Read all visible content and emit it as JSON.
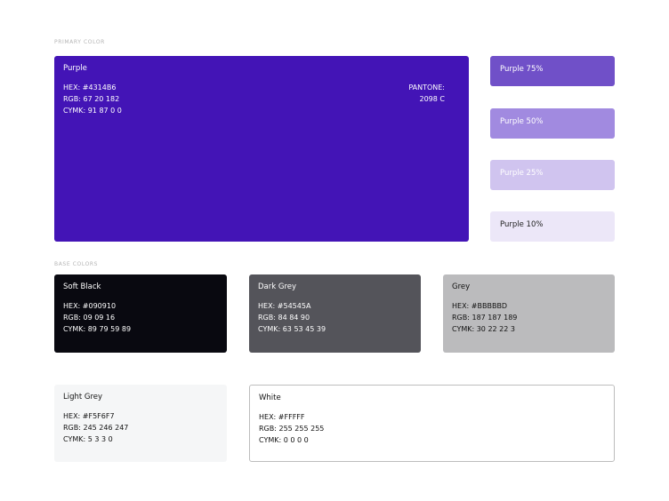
{
  "sections": {
    "primary_label": "PRIMARY COLOR",
    "base_label": "BASE COLORS"
  },
  "primary": {
    "name": "Purple",
    "hex": "HEX: #4314B6",
    "rgb": "RGB: 67 20 182",
    "cymk": "CYMK: 91 87 0 0",
    "pantone_label": "PANTONE:",
    "pantone_value": "2098 C",
    "color": "#4314B6"
  },
  "tints": [
    {
      "label": "Purple 75%",
      "color": "#7050C8"
    },
    {
      "label": "Purple 50%",
      "color": "#A18AE0"
    },
    {
      "label": "Purple 25%",
      "color": "#D0C4EF"
    },
    {
      "label": "Purple 10%",
      "color": "#ECE7F8"
    }
  ],
  "base": [
    {
      "name": "Soft Black",
      "hex": "HEX: #090910",
      "rgb": "RGB: 09 09 16",
      "cymk": "CYMK: 89 79 59 89",
      "color": "#090910"
    },
    {
      "name": "Dark Grey",
      "hex": "HEX: #54545A",
      "rgb": "RGB: 84 84 90",
      "cymk": "CYMK: 63 53 45 39",
      "color": "#54545A"
    },
    {
      "name": "Grey",
      "hex": "HEX: #BBBBBD",
      "rgb": "RGB: 187 187 189",
      "cymk": "CYMK: 30 22 22 3",
      "color": "#BBBBBD"
    },
    {
      "name": "Light Grey",
      "hex": "HEX: #F5F6F7",
      "rgb": "RGB: 245 246 247",
      "cymk": "CYMK: 5 3 3 0",
      "color": "#F5F6F7"
    },
    {
      "name": "White",
      "hex": "HEX: #FFFFF",
      "rgb": "RGB: 255 255 255",
      "cymk": "CYMK: 0 0 0 0",
      "color": "#FFFFFF"
    }
  ]
}
